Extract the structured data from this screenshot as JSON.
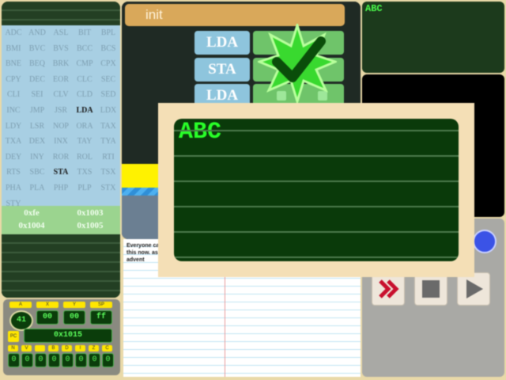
{
  "mnemonics": [
    "ADC",
    "AND",
    "ASL",
    "BIT",
    "BPL",
    "BMI",
    "BVC",
    "BVS",
    "BCC",
    "BCS",
    "BNE",
    "BEQ",
    "BRK",
    "CMP",
    "CPX",
    "CPY",
    "DEC",
    "EOR",
    "CLC",
    "SEC",
    "CLI",
    "SEI",
    "CLV",
    "CLD",
    "SED",
    "INC",
    "JMP",
    "JSR",
    "LDA",
    "LDX",
    "LDY",
    "LSR",
    "NOP",
    "ORA",
    "TAX",
    "TXA",
    "DEX",
    "INX",
    "TAY",
    "TYA",
    "DEY",
    "INY",
    "ROR",
    "ROL",
    "RTI",
    "RTS",
    "SBC",
    "STA",
    "TXS",
    "TSX",
    "PHA",
    "PLA",
    "PHP",
    "PLP",
    "STX",
    "STY"
  ],
  "highlighted": [
    "LDA",
    "STA"
  ],
  "memory": {
    "addresses": [
      "0xfe",
      "0x1003",
      "0x1004",
      "0x1005"
    ]
  },
  "registers": {
    "labels": [
      "A",
      "X",
      "Y",
      "SP"
    ],
    "values": [
      "41",
      "00",
      "00",
      "ff"
    ],
    "pc_label": "PC",
    "pc_value": "0x1015",
    "flag_labels": [
      "N",
      "V",
      "",
      "B",
      "D",
      "I",
      "Z",
      "C"
    ],
    "flag_values": [
      "0",
      "0",
      "0",
      "0",
      "0",
      "0",
      "0",
      "0"
    ]
  },
  "program": {
    "label": "init",
    "instructions": [
      "LDA",
      "STA",
      "LDA"
    ]
  },
  "notebook": {
    "text": "Everyone can see this now. ass advent"
  },
  "text_screen": {
    "text": "ABC"
  },
  "mini_screen": {
    "text": "ABC"
  },
  "controls": [
    "fast-forward-icon",
    "stop-icon",
    "play-icon"
  ],
  "colors": {
    "screen_text": "#28ff28",
    "init_bar": "#d9a85a",
    "instruction": "#8ec5dd",
    "highlight_bar": "#fff200"
  }
}
